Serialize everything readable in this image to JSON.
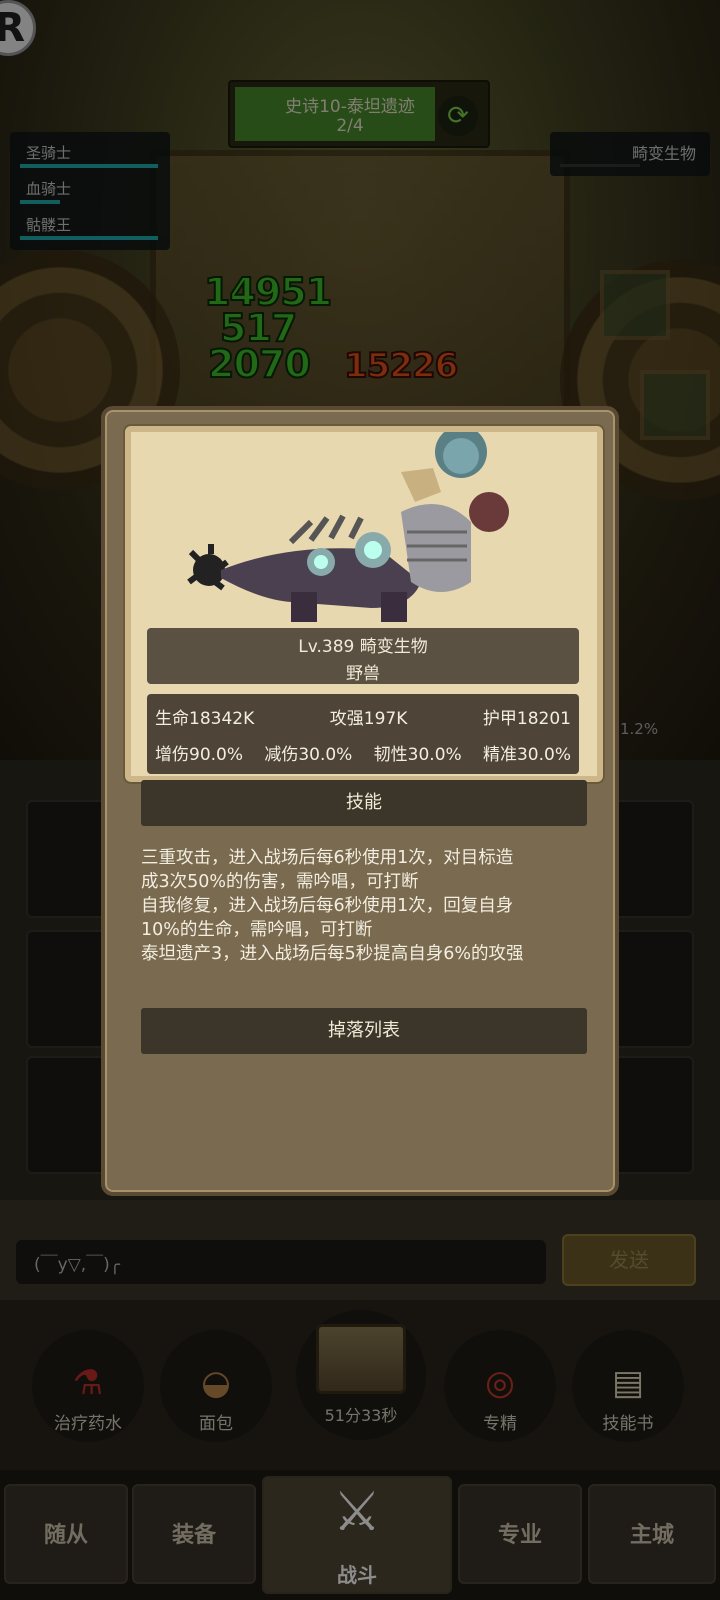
{
  "stage": {
    "title": "史诗10-泰坦遗迹",
    "progress_text": "2/4",
    "progress": 0.8
  },
  "team": [
    {
      "name": "圣骑士"
    },
    {
      "name": "血骑士"
    },
    {
      "name": "骷髅王"
    }
  ],
  "enemy": {
    "name": "畸变生物"
  },
  "damage_numbers": [
    "14951",
    "517",
    "2070",
    "15226"
  ],
  "side_percent": "1.2%",
  "monster": {
    "level_name": "Lv.389 畸变生物",
    "type": "野兽",
    "stats_row1": [
      "生命18342K",
      "攻强197K",
      "护甲18201"
    ],
    "stats_row2": [
      "增伤90.0%",
      "减伤30.0%",
      "韧性30.0%",
      "精准30.0%"
    ]
  },
  "skills": {
    "header": "技能",
    "lines": [
      "三重攻击，进入战场后每6秒使用1次，对目标造",
      "成3次50%的伤害，需吟唱，可打断",
      "自我修复，进入战场后每6秒使用1次，回复自身",
      "10%的生命，需吟唱，可打断",
      "泰坦遗产3，进入战场后每5秒提高自身6%的攻强"
    ]
  },
  "drop_list_label": "掉落列表",
  "chat": {
    "placeholder": "(￣y▽,￣)╭",
    "send_label": "发送"
  },
  "quick_actions": [
    {
      "label": "治疗药水",
      "icon": "potion-icon"
    },
    {
      "label": "面包",
      "icon": "bread-icon"
    },
    {
      "label": "专精",
      "icon": "mastery-icon"
    },
    {
      "label": "技能书",
      "icon": "skill-book-icon"
    }
  ],
  "chest_timer": "51分33秒",
  "nav": {
    "tabs": [
      "随从",
      "装备",
      "战斗",
      "专业",
      "主城"
    ],
    "active": "战斗"
  },
  "colors": {
    "modal_bg": "#7a6a50",
    "card_bg": "#e8d8b0",
    "band_dark": "#3c352a",
    "damage_green": "#3fbf2a",
    "damage_red": "#e0521a",
    "health_teal": "#22aaaa"
  }
}
